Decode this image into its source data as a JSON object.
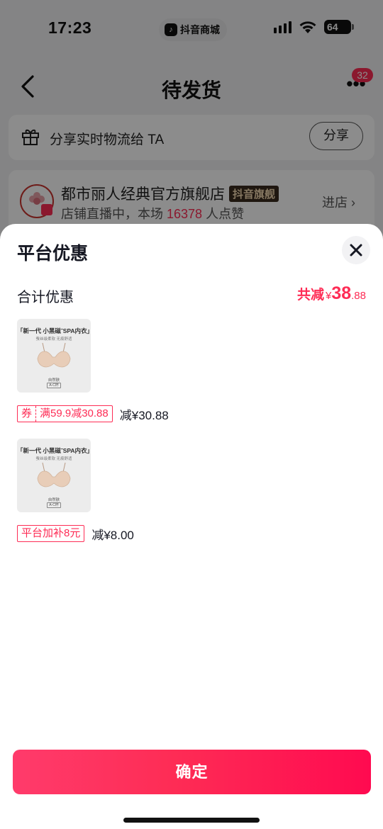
{
  "status_bar": {
    "time": "17:23",
    "app_pill": "抖音商城",
    "battery": "64"
  },
  "nav": {
    "title": "待发货",
    "badge_count": "32"
  },
  "share_card": {
    "text": "分享实时物流给 TA",
    "button": "分享"
  },
  "shop_card": {
    "name": "都市丽人经典官方旗舰店",
    "tag": "抖音旗舰",
    "sub_prefix": "店铺直播中，本场 ",
    "likes": "16378",
    "sub_suffix": " 人点赞",
    "enter": "进店 ›"
  },
  "sheet": {
    "title": "平台优惠",
    "total_label": "合计优惠",
    "total_prefix": "共减",
    "total_yen": "¥",
    "total_int": "38",
    "total_dec": ".88",
    "items": [
      {
        "thumb_caption": "「新一代 小黑磁˜SPA内衣」",
        "thumb_sub": "蚕丝级柔软 无痕舒适",
        "thumb_color": "自然肤",
        "thumb_size": "A-C杯",
        "coupon_type": "券",
        "coupon_text": "满59.9减30.88",
        "reduce": "减¥30.88"
      },
      {
        "thumb_caption": "「新一代 小黑磁˜SPA内衣」",
        "thumb_sub": "蚕丝级柔软 无痕舒适",
        "thumb_color": "自然肤",
        "thumb_size": "A-C杯",
        "subsidy": "平台加补8元",
        "reduce": "减¥8.00"
      }
    ],
    "confirm": "确定"
  },
  "colors": {
    "accent": "#fe2c55",
    "text": "#161823"
  }
}
